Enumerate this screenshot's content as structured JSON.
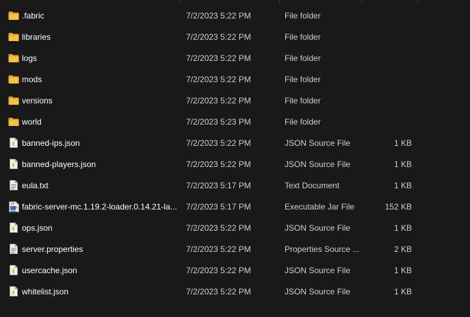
{
  "colors": {
    "background": "#191919",
    "folder": "#f5c242",
    "folder_dark": "#dfa82a",
    "text": "#ffffff",
    "secondary_text": "#cfcfcf"
  },
  "files": [
    {
      "name": ".fabric",
      "date": "7/2/2023 5:22 PM",
      "type": "File folder",
      "size": "",
      "icon": "folder-icon"
    },
    {
      "name": "libraries",
      "date": "7/2/2023 5:22 PM",
      "type": "File folder",
      "size": "",
      "icon": "folder-icon"
    },
    {
      "name": "logs",
      "date": "7/2/2023 5:22 PM",
      "type": "File folder",
      "size": "",
      "icon": "folder-icon"
    },
    {
      "name": "mods",
      "date": "7/2/2023 5:22 PM",
      "type": "File folder",
      "size": "",
      "icon": "folder-icon"
    },
    {
      "name": "versions",
      "date": "7/2/2023 5:22 PM",
      "type": "File folder",
      "size": "",
      "icon": "folder-icon"
    },
    {
      "name": "world",
      "date": "7/2/2023 5:23 PM",
      "type": "File folder",
      "size": "",
      "icon": "folder-icon"
    },
    {
      "name": "banned-ips.json",
      "date": "7/2/2023 5:22 PM",
      "type": "JSON Source File",
      "size": "1 KB",
      "icon": "json-file-icon"
    },
    {
      "name": "banned-players.json",
      "date": "7/2/2023 5:22 PM",
      "type": "JSON Source File",
      "size": "1 KB",
      "icon": "json-file-icon"
    },
    {
      "name": "eula.txt",
      "date": "7/2/2023 5:17 PM",
      "type": "Text Document",
      "size": "1 KB",
      "icon": "text-file-icon"
    },
    {
      "name": "fabric-server-mc.1.19.2-loader.0.14.21-la...",
      "date": "7/2/2023 5:17 PM",
      "type": "Executable Jar File",
      "size": "152 KB",
      "icon": "jar-file-icon"
    },
    {
      "name": "ops.json",
      "date": "7/2/2023 5:22 PM",
      "type": "JSON Source File",
      "size": "1 KB",
      "icon": "json-file-icon"
    },
    {
      "name": "server.properties",
      "date": "7/2/2023 5:22 PM",
      "type": "Properties Source ...",
      "size": "2 KB",
      "icon": "text-file-icon"
    },
    {
      "name": "usercache.json",
      "date": "7/2/2023 5:22 PM",
      "type": "JSON Source File",
      "size": "1 KB",
      "icon": "json-file-icon"
    },
    {
      "name": "whitelist.json",
      "date": "7/2/2023 5:22 PM",
      "type": "JSON Source File",
      "size": "1 KB",
      "icon": "json-file-icon"
    }
  ]
}
